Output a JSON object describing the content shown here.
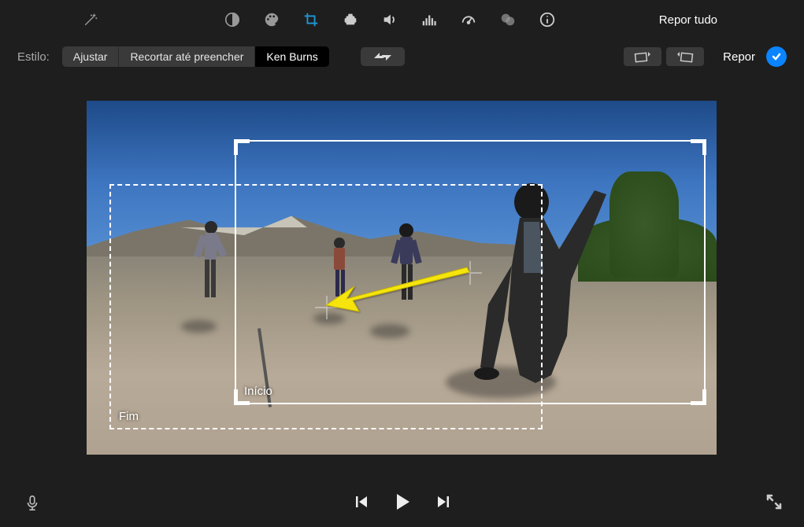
{
  "toolbar": {
    "reset_all": "Repor tudo"
  },
  "crop_bar": {
    "style_label": "Estilo:",
    "fit_label": "Ajustar",
    "crop_fill_label": "Recortar até preencher",
    "ken_burns_label": "Ken Burns",
    "reset_label": "Repor"
  },
  "frames": {
    "start_label": "Início",
    "end_label": "Fim"
  },
  "colors": {
    "accent": "#0a84ff",
    "crop_active": "#2196d8"
  }
}
